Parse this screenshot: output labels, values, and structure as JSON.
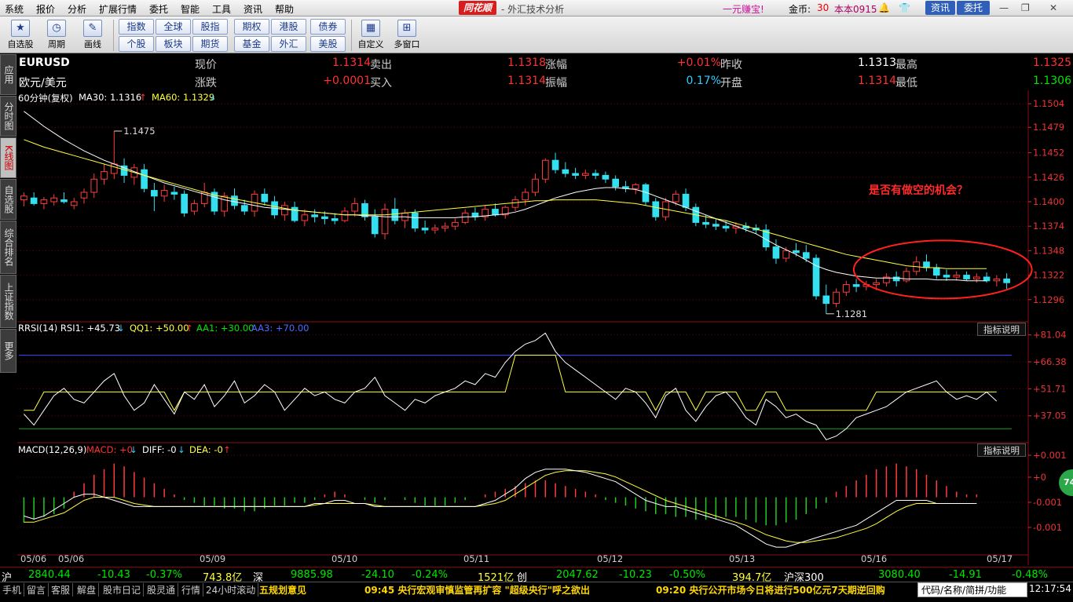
{
  "menu": {
    "items": [
      "系统",
      "报价",
      "分析",
      "扩展行情",
      "委托",
      "智能",
      "工具",
      "资讯",
      "帮助"
    ],
    "logo": "同花顺",
    "title": "- 外汇技术分析",
    "promo": "一元赚宝!",
    "gold_label": "金币:",
    "gold_value": "30",
    "user": "本本0915",
    "btn_info": "资讯",
    "btn_trade": "委托"
  },
  "toolbar": {
    "big": [
      {
        "label": "自选股",
        "icon": "star-icon"
      },
      {
        "label": "周期",
        "icon": "clock-icon"
      },
      {
        "label": "画线",
        "icon": "pencil-icon"
      },
      {
        "label": "自定义",
        "icon": "custom-icon"
      },
      {
        "label": "多窗口",
        "icon": "windows-icon"
      }
    ],
    "grid": [
      [
        "指数",
        "全球",
        "股指",
        "期权",
        "港股",
        "债券"
      ],
      [
        "个股",
        "板块",
        "期货",
        "基金",
        "外汇",
        "美股"
      ]
    ]
  },
  "side_tabs": [
    "应用",
    "分时图",
    "K线图",
    "自选股",
    "综合排名",
    "上证指数",
    "更多"
  ],
  "quote": {
    "code": "EURUSD",
    "name": "欧元/美元",
    "rows": [
      [
        {
          "l": "现价",
          "v": "1.1314",
          "c": "red"
        },
        {
          "l": "卖出",
          "v": "1.1318",
          "c": "red"
        },
        {
          "l": "涨幅",
          "v": "+0.01%",
          "c": "red"
        },
        {
          "l": "昨收",
          "v": "1.1313",
          "c": "white"
        },
        {
          "l": "最高",
          "v": "1.1325",
          "c": "red"
        }
      ],
      [
        {
          "l": "涨跌",
          "v": "+0.0001",
          "c": "red"
        },
        {
          "l": "买入",
          "v": "1.1314",
          "c": "red"
        },
        {
          "l": "振幅",
          "v": "0.17%",
          "c": "cyan"
        },
        {
          "l": "开盘",
          "v": "1.1314",
          "c": "red"
        },
        {
          "l": "最低",
          "v": "1.1306",
          "c": "green"
        }
      ]
    ]
  },
  "kline": {
    "period": "60分钟(复权)",
    "ma30_label": "MA30: 1.1316",
    "ma60_label": "MA60: 1.1329",
    "y_ticks": [
      "1.1504",
      "1.1479",
      "1.1452",
      "1.1426",
      "1.1400",
      "1.1374",
      "1.1348",
      "1.1322",
      "1.1296"
    ],
    "high_mark": "1.1475",
    "low_mark": "1.1281",
    "annotation": "是否有做空的机会？"
  },
  "rsi": {
    "label": "RRSI(14) RSI1: +45.73",
    "qq1": "QQ1: +50.00",
    "aa1": "AA1: +30.00",
    "aa3": "AA3: +70.00",
    "explain": "指标说明",
    "y_ticks": [
      "+81.04",
      "+66.38",
      "+51.71",
      "+37.05"
    ]
  },
  "macd": {
    "label": "MACD(12,26,9)",
    "macd": "MACD: +0",
    "diff": "DIFF: -0",
    "dea": "DEA: -0",
    "explain": "指标说明",
    "y_ticks": [
      "+0.001",
      "+0",
      "-0.001",
      "-0.001"
    ]
  },
  "x_dates": [
    "05/06",
    "05/06",
    "05/09",
    "05/10",
    "05/11",
    "05/12",
    "05/13",
    "05/16",
    "05/17"
  ],
  "chart_data": {
    "type": "candlestick",
    "title": "EURUSD 60分钟",
    "ylim": [
      1.1275,
      1.151
    ],
    "ohlc": [
      [
        1.1402,
        1.141,
        1.1395,
        1.1406
      ],
      [
        1.1404,
        1.141,
        1.1396,
        1.1398
      ],
      [
        1.1398,
        1.1405,
        1.1392,
        1.1402
      ],
      [
        1.14,
        1.1408,
        1.1396,
        1.1404
      ],
      [
        1.1402,
        1.141,
        1.1398,
        1.14
      ],
      [
        1.1396,
        1.1404,
        1.1392,
        1.14
      ],
      [
        1.1404,
        1.1414,
        1.1398,
        1.141
      ],
      [
        1.141,
        1.143,
        1.1404,
        1.1424
      ],
      [
        1.1424,
        1.144,
        1.1418,
        1.1432
      ],
      [
        1.143,
        1.1475,
        1.1424,
        1.144
      ],
      [
        1.1438,
        1.1446,
        1.142,
        1.1428
      ],
      [
        1.1426,
        1.144,
        1.1418,
        1.1436
      ],
      [
        1.1434,
        1.144,
        1.141,
        1.1414
      ],
      [
        1.1412,
        1.142,
        1.139,
        1.1406
      ],
      [
        1.1406,
        1.1418,
        1.14,
        1.1412
      ],
      [
        1.141,
        1.1416,
        1.1402,
        1.1408
      ],
      [
        1.1408,
        1.1412,
        1.1384,
        1.1388
      ],
      [
        1.139,
        1.1402,
        1.1386,
        1.1398
      ],
      [
        1.1398,
        1.142,
        1.1394,
        1.141
      ],
      [
        1.141,
        1.1414,
        1.1386,
        1.139
      ],
      [
        1.139,
        1.141,
        1.1384,
        1.1406
      ],
      [
        1.1406,
        1.1414,
        1.1392,
        1.1396
      ],
      [
        1.1396,
        1.1402,
        1.1386,
        1.139
      ],
      [
        1.139,
        1.1412,
        1.1384,
        1.1408
      ],
      [
        1.1408,
        1.1414,
        1.1396,
        1.14
      ],
      [
        1.14,
        1.1406,
        1.1382,
        1.1386
      ],
      [
        1.1386,
        1.14,
        1.138,
        1.1396
      ],
      [
        1.1394,
        1.14,
        1.1378,
        1.138
      ],
      [
        1.138,
        1.1392,
        1.1374,
        1.1386
      ],
      [
        1.1386,
        1.1392,
        1.1378,
        1.1384
      ],
      [
        1.1384,
        1.139,
        1.1376,
        1.1382
      ],
      [
        1.1382,
        1.1388,
        1.1376,
        1.138
      ],
      [
        1.138,
        1.1394,
        1.1378,
        1.139
      ],
      [
        1.139,
        1.1404,
        1.1384,
        1.1398
      ],
      [
        1.1398,
        1.1402,
        1.138,
        1.1384
      ],
      [
        1.1384,
        1.1392,
        1.1362,
        1.1366
      ],
      [
        1.1366,
        1.1398,
        1.136,
        1.1392
      ],
      [
        1.1392,
        1.1404,
        1.1376,
        1.138
      ],
      [
        1.138,
        1.1392,
        1.1372,
        1.1388
      ],
      [
        1.1388,
        1.1392,
        1.1368,
        1.1372
      ],
      [
        1.1372,
        1.138,
        1.1366,
        1.137
      ],
      [
        1.137,
        1.1376,
        1.1366,
        1.1372
      ],
      [
        1.1372,
        1.1378,
        1.1368,
        1.1374
      ],
      [
        1.1374,
        1.1382,
        1.137,
        1.1378
      ],
      [
        1.1378,
        1.1392,
        1.1376,
        1.1388
      ],
      [
        1.1388,
        1.1394,
        1.138,
        1.1384
      ],
      [
        1.1384,
        1.1396,
        1.138,
        1.1392
      ],
      [
        1.1392,
        1.1398,
        1.1384,
        1.1386
      ],
      [
        1.1386,
        1.1396,
        1.1382,
        1.1394
      ],
      [
        1.1394,
        1.1406,
        1.139,
        1.1402
      ],
      [
        1.1402,
        1.1414,
        1.1396,
        1.141
      ],
      [
        1.141,
        1.143,
        1.1406,
        1.1424
      ],
      [
        1.1424,
        1.1446,
        1.142,
        1.1444
      ],
      [
        1.1444,
        1.1452,
        1.143,
        1.1434
      ],
      [
        1.1434,
        1.1442,
        1.1426,
        1.143
      ],
      [
        1.143,
        1.1436,
        1.1424,
        1.1428
      ],
      [
        1.1428,
        1.1434,
        1.1424,
        1.143
      ],
      [
        1.143,
        1.1434,
        1.1424,
        1.1428
      ],
      [
        1.1428,
        1.1432,
        1.142,
        1.1424
      ],
      [
        1.1424,
        1.1428,
        1.1412,
        1.1416
      ],
      [
        1.1416,
        1.1422,
        1.141,
        1.1414
      ],
      [
        1.1414,
        1.142,
        1.1408,
        1.1418
      ],
      [
        1.1418,
        1.142,
        1.1396,
        1.14
      ],
      [
        1.14,
        1.1404,
        1.138,
        1.1384
      ],
      [
        1.1384,
        1.1404,
        1.138,
        1.14
      ],
      [
        1.14,
        1.1412,
        1.1396,
        1.1408
      ],
      [
        1.1408,
        1.1414,
        1.139,
        1.1394
      ],
      [
        1.1394,
        1.1398,
        1.1374,
        1.1378
      ],
      [
        1.1378,
        1.1386,
        1.1372,
        1.1376
      ],
      [
        1.1376,
        1.1382,
        1.137,
        1.1374
      ],
      [
        1.1374,
        1.138,
        1.1368,
        1.1372
      ],
      [
        1.1372,
        1.1378,
        1.1366,
        1.1374
      ],
      [
        1.1374,
        1.1378,
        1.1368,
        1.1372
      ],
      [
        1.1372,
        1.1376,
        1.1366,
        1.137
      ],
      [
        1.137,
        1.1376,
        1.1348,
        1.1352
      ],
      [
        1.1352,
        1.136,
        1.1334,
        1.134
      ],
      [
        1.134,
        1.1352,
        1.1336,
        1.1348
      ],
      [
        1.1348,
        1.1356,
        1.1342,
        1.1346
      ],
      [
        1.1346,
        1.1354,
        1.1336,
        1.134
      ],
      [
        1.134,
        1.1344,
        1.1296,
        1.13
      ],
      [
        1.13,
        1.1312,
        1.1281,
        1.1292
      ],
      [
        1.1292,
        1.1308,
        1.1288,
        1.1304
      ],
      [
        1.1304,
        1.1316,
        1.13,
        1.1312
      ],
      [
        1.1312,
        1.1318,
        1.1304,
        1.131
      ],
      [
        1.131,
        1.1316,
        1.1306,
        1.1312
      ],
      [
        1.1312,
        1.1318,
        1.1306,
        1.1314
      ],
      [
        1.1314,
        1.1324,
        1.131,
        1.132
      ],
      [
        1.132,
        1.1326,
        1.131,
        1.1316
      ],
      [
        1.1316,
        1.133,
        1.1314,
        1.1326
      ],
      [
        1.1326,
        1.1342,
        1.1322,
        1.1336
      ],
      [
        1.1336,
        1.1344,
        1.1326,
        1.133
      ],
      [
        1.133,
        1.1334,
        1.1318,
        1.1322
      ],
      [
        1.1322,
        1.1328,
        1.1316,
        1.132
      ],
      [
        1.132,
        1.1326,
        1.1316,
        1.1322
      ],
      [
        1.1322,
        1.1326,
        1.1316,
        1.1318
      ],
      [
        1.1318,
        1.1324,
        1.1314,
        1.132
      ],
      [
        1.132,
        1.1325,
        1.1314,
        1.1316
      ],
      [
        1.1316,
        1.1322,
        1.131,
        1.1318
      ],
      [
        1.1318,
        1.1324,
        1.1306,
        1.1314
      ]
    ],
    "ma30": [
      1.1496,
      1.1488,
      1.148,
      1.1473,
      1.1466,
      1.146,
      1.1454,
      1.1449,
      1.1444,
      1.144,
      1.1436,
      1.1432,
      1.1428,
      1.1424,
      1.142,
      1.1417,
      1.1414,
      1.1411,
      1.1408,
      1.1405,
      1.1402,
      1.14,
      1.1398,
      1.1396,
      1.1394,
      1.1393,
      1.1392,
      1.1391,
      1.139,
      1.1389,
      1.1388,
      1.1387,
      1.1386,
      1.1386,
      1.1385,
      1.1385,
      1.1384,
      1.1384,
      1.1384,
      1.1383,
      1.1383,
      1.1383,
      1.1383,
      1.1383,
      1.1384,
      1.1384,
      1.1385,
      1.1386,
      1.1387,
      1.1389,
      1.1392,
      1.1396,
      1.14,
      1.1404,
      1.1407,
      1.141,
      1.1412,
      1.1414,
      1.1415,
      1.1415,
      1.1414,
      1.1413,
      1.141,
      1.1406,
      1.1402,
      1.1398,
      1.1394,
      1.139,
      1.1386,
      1.1382,
      1.1378,
      1.1374,
      1.137,
      1.1366,
      1.136,
      1.1354,
      1.1349,
      1.1344,
      1.1338,
      1.1332,
      1.1328,
      1.1325,
      1.1323,
      1.1321,
      1.132,
      1.1319,
      1.1319,
      1.1319,
      1.1318,
      1.1318,
      1.1318,
      1.1317,
      1.1317,
      1.1317,
      1.1316,
      1.1316,
      1.1316
    ],
    "ma60": [
      1.1466,
      1.1462,
      1.1458,
      1.1455,
      1.1452,
      1.1449,
      1.1446,
      1.1443,
      1.144,
      1.1437,
      1.1434,
      1.1431,
      1.1428,
      1.1425,
      1.1422,
      1.1419,
      1.1416,
      1.1413,
      1.141,
      1.1407,
      1.1405,
      1.1403,
      1.1401,
      1.1399,
      1.1397,
      1.1395,
      1.1393,
      1.1391,
      1.139,
      1.1389,
      1.1388,
      1.1387,
      1.1386,
      1.1386,
      1.1386,
      1.1386,
      1.1386,
      1.1387,
      1.1388,
      1.1389,
      1.139,
      1.1391,
      1.1392,
      1.1393,
      1.1394,
      1.1395,
      1.1396,
      1.1397,
      1.1398,
      1.1399,
      1.14,
      1.1401,
      1.1401,
      1.1402,
      1.1402,
      1.1402,
      1.1402,
      1.1402,
      1.1401,
      1.14,
      1.1399,
      1.1398,
      1.1396,
      1.1394,
      1.1392,
      1.139,
      1.1388,
      1.1386,
      1.1384,
      1.1382,
      1.138,
      1.1377,
      1.1374,
      1.1371,
      1.1368,
      1.1365,
      1.1362,
      1.1359,
      1.1356,
      1.1353,
      1.135,
      1.1347,
      1.1344,
      1.1342,
      1.134,
      1.1338,
      1.1336,
      1.1334,
      1.1332,
      1.1331,
      1.133,
      1.133,
      1.1329,
      1.1329,
      1.1329,
      1.1329,
      1.1329
    ],
    "rsi": [
      38,
      32,
      40,
      48,
      52,
      46,
      44,
      50,
      56,
      60,
      48,
      40,
      44,
      54,
      46,
      38,
      50,
      46,
      54,
      42,
      48,
      56,
      44,
      48,
      54,
      50,
      40,
      46,
      52,
      48,
      50,
      46,
      44,
      50,
      52,
      58,
      48,
      44,
      40,
      46,
      44,
      48,
      50,
      52,
      56,
      54,
      60,
      58,
      66,
      72,
      76,
      78,
      82,
      72,
      66,
      62,
      58,
      54,
      50,
      46,
      52,
      50,
      44,
      36,
      48,
      52,
      40,
      34,
      42,
      48,
      50,
      44,
      36,
      32,
      46,
      42,
      36,
      38,
      34,
      32,
      24,
      26,
      30,
      36,
      38,
      40,
      42,
      46,
      50,
      52,
      54,
      56,
      50,
      46,
      48,
      46,
      50,
      45
    ],
    "macd_hist": [
      -0.9,
      -0.8,
      -0.7,
      -0.6,
      -0.4,
      0.2,
      0.5,
      0.8,
      1.0,
      1.2,
      1.1,
      0.9,
      0.7,
      0.5,
      0.3,
      0.1,
      -0.1,
      -0.2,
      -0.3,
      -0.3,
      -0.4,
      -0.4,
      -0.5,
      -0.5,
      -0.4,
      -0.3,
      -0.3,
      -0.2,
      -0.2,
      -0.1,
      0.1,
      0.2,
      0.1,
      0.0,
      -0.1,
      -0.2,
      -0.1,
      0.0,
      -0.1,
      -0.2,
      -0.3,
      -0.3,
      -0.3,
      -0.2,
      -0.1,
      0.0,
      0.1,
      0.2,
      0.3,
      0.4,
      0.5,
      0.6,
      0.6,
      0.5,
      0.4,
      0.3,
      0.2,
      0.1,
      -0.1,
      -0.2,
      -0.3,
      -0.4,
      -0.5,
      -0.6,
      -0.6,
      -0.7,
      -0.7,
      -0.8,
      -0.8,
      -0.8,
      -0.7,
      -0.7,
      -0.8,
      -0.9,
      -1.0,
      -1.0,
      -0.9,
      -0.8,
      -0.6,
      -0.4,
      -0.2,
      0.2,
      0.4,
      0.6,
      0.8,
      1.0,
      1.1,
      1.2,
      1.1,
      1.0,
      0.8,
      0.6,
      0.4,
      0.2,
      0.1,
      0.1,
      0.0
    ],
    "macd_diff": [
      -0.6,
      -0.7,
      -0.6,
      -0.4,
      -0.2,
      0.0,
      0.1,
      0.1,
      0.0,
      -0.1,
      -0.2,
      -0.3,
      -0.3,
      -0.3,
      -0.3,
      -0.3,
      -0.3,
      -0.3,
      -0.3,
      -0.3,
      -0.3,
      -0.3,
      -0.3,
      -0.3,
      -0.3,
      -0.3,
      -0.3,
      -0.3,
      -0.3,
      -0.2,
      -0.2,
      -0.1,
      -0.1,
      -0.2,
      -0.2,
      -0.3,
      -0.3,
      -0.3,
      -0.3,
      -0.3,
      -0.3,
      -0.3,
      -0.3,
      -0.3,
      -0.3,
      -0.3,
      -0.2,
      -0.1,
      0.1,
      0.3,
      0.6,
      0.8,
      0.9,
      0.9,
      0.9,
      0.85,
      0.8,
      0.7,
      0.6,
      0.5,
      0.3,
      0.1,
      -0.1,
      -0.2,
      -0.3,
      -0.3,
      -0.4,
      -0.5,
      -0.6,
      -0.7,
      -0.8,
      -0.9,
      -1.1,
      -1.3,
      -1.5,
      -1.6,
      -1.6,
      -1.5,
      -1.4,
      -1.3,
      -1.2,
      -1.1,
      -1.0,
      -0.9,
      -0.7,
      -0.5,
      -0.3,
      -0.1,
      -0.1,
      -0.1,
      -0.1,
      -0.2,
      -0.2,
      -0.2,
      -0.2,
      -0.2
    ],
    "macd_dea": [
      -0.8,
      -0.8,
      -0.7,
      -0.6,
      -0.5,
      -0.3,
      -0.1,
      0.0,
      0.0,
      0.0,
      -0.1,
      -0.2,
      -0.25,
      -0.3,
      -0.3,
      -0.3,
      -0.3,
      -0.3,
      -0.3,
      -0.3,
      -0.3,
      -0.3,
      -0.3,
      -0.3,
      -0.3,
      -0.3,
      -0.3,
      -0.3,
      -0.3,
      -0.25,
      -0.2,
      -0.2,
      -0.2,
      -0.2,
      -0.2,
      -0.25,
      -0.3,
      -0.3,
      -0.3,
      -0.3,
      -0.3,
      -0.3,
      -0.3,
      -0.3,
      -0.3,
      -0.3,
      -0.25,
      -0.2,
      -0.1,
      0.1,
      0.3,
      0.5,
      0.7,
      0.8,
      0.85,
      0.85,
      0.85,
      0.8,
      0.75,
      0.65,
      0.5,
      0.35,
      0.2,
      0.05,
      -0.1,
      -0.2,
      -0.3,
      -0.4,
      -0.5,
      -0.6,
      -0.7,
      -0.8,
      -0.9,
      -1.05,
      -1.2,
      -1.3,
      -1.4,
      -1.45,
      -1.45,
      -1.4,
      -1.35,
      -1.3,
      -1.2,
      -1.1,
      -1.0,
      -0.85,
      -0.65,
      -0.45,
      -0.3,
      -0.2,
      -0.2,
      -0.2,
      -0.2,
      -0.2,
      -0.2,
      -0.2
    ]
  },
  "status1": [
    {
      "t": "沪",
      "c": "white"
    },
    {
      "t": "2840.44",
      "c": "green"
    },
    {
      "t": "-10.43",
      "c": "green"
    },
    {
      "t": "-0.37%",
      "c": "green"
    },
    {
      "t": "743.8亿",
      "c": "yellow"
    },
    {
      "t": "深",
      "c": "white"
    },
    {
      "t": "9885.98",
      "c": "green"
    },
    {
      "t": "-24.10",
      "c": "green"
    },
    {
      "t": "-0.24%",
      "c": "green"
    },
    {
      "t": "1521亿",
      "c": "yellow"
    },
    {
      "t": "创",
      "c": "white"
    },
    {
      "t": "2047.62",
      "c": "green"
    },
    {
      "t": "-10.23",
      "c": "green"
    },
    {
      "t": "-0.50%",
      "c": "green"
    },
    {
      "t": "394.7亿",
      "c": "yellow"
    },
    {
      "t": "沪深300",
      "c": "white"
    },
    {
      "t": "3080.40",
      "c": "green"
    },
    {
      "t": "-14.91",
      "c": "green"
    },
    {
      "t": "-0.48%",
      "c": "green"
    }
  ],
  "status2": {
    "tabs": [
      "手机",
      "留言",
      "客服",
      "解盘",
      "股市日记",
      "股灵通",
      "行情",
      "24小时滚动"
    ],
    "news1": "五规划意见",
    "news2": "09:45 央行宏观审慎监管再扩容 \"超级央行\"呼之欲出",
    "news3": "09:20 央行公开市场今日将进行500亿元7天期逆回购",
    "search": "代码/名称/简拼/功能",
    "clock": "12:17:54",
    "float_ball": "74"
  }
}
